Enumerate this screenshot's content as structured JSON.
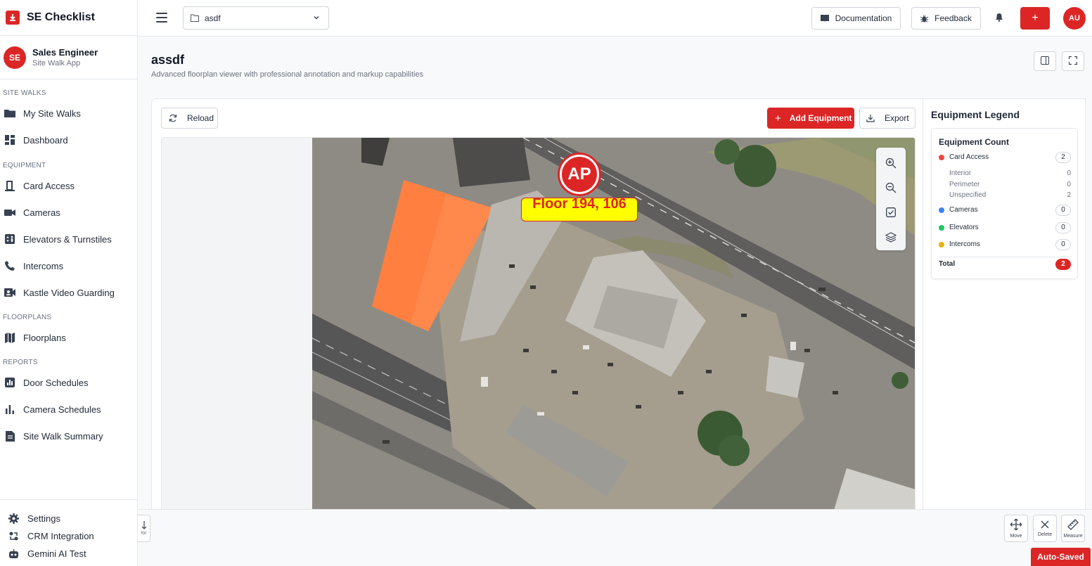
{
  "app": {
    "title": "SE Checklist"
  },
  "user": {
    "initials": "SE",
    "name": "Sales Engineer",
    "subtitle": "Site Walk App",
    "avatar_initials": "AU"
  },
  "sidebar": {
    "sections": [
      {
        "label": "SITE WALKS",
        "items": [
          {
            "label": "My Site Walks",
            "icon": "folder-icon"
          },
          {
            "label": "Dashboard",
            "icon": "dashboard-icon"
          }
        ]
      },
      {
        "label": "EQUIPMENT",
        "items": [
          {
            "label": "Card Access",
            "icon": "door-icon"
          },
          {
            "label": "Cameras",
            "icon": "video-camera-icon"
          },
          {
            "label": "Elevators & Turnstiles",
            "icon": "elevator-icon"
          },
          {
            "label": "Intercoms",
            "icon": "phone-icon"
          },
          {
            "label": "Kastle Video Guarding",
            "icon": "video-guard-icon"
          }
        ]
      },
      {
        "label": "FLOORPLANS",
        "items": [
          {
            "label": "Floorplans",
            "icon": "map-icon"
          }
        ]
      },
      {
        "label": "REPORTS",
        "items": [
          {
            "label": "Door Schedules",
            "icon": "bar-chart-icon"
          },
          {
            "label": "Camera Schedules",
            "icon": "bar-chart-icon"
          },
          {
            "label": "Site Walk Summary",
            "icon": "document-icon"
          }
        ]
      }
    ],
    "bottom": [
      {
        "label": "Settings",
        "icon": "gear-icon"
      },
      {
        "label": "CRM Integration",
        "icon": "sync-icon"
      },
      {
        "label": "Gemini AI Test",
        "icon": "robot-icon"
      }
    ]
  },
  "header": {
    "project": "asdf",
    "documentation_label": "Documentation",
    "feedback_label": "Feedback",
    "add_label": "+"
  },
  "page": {
    "title": "assdf",
    "subtitle": "Advanced floorplan viewer with professional annotation and markup capabilities"
  },
  "viewer": {
    "reload_label": "Reload",
    "add_equipment_label": "Add Equipment",
    "export_label": "Export",
    "marker": {
      "badge": "AP",
      "label": "Floor 194, 106"
    }
  },
  "legend": {
    "title": "Equipment Legend",
    "card_title": "Equipment Count",
    "items": [
      {
        "label": "Card Access",
        "count": "2",
        "color": "#ef4444"
      },
      {
        "label": "Cameras",
        "count": "0",
        "color": "#3b82f6"
      },
      {
        "label": "Elevators",
        "count": "0",
        "color": "#22c55e"
      },
      {
        "label": "Intercoms",
        "count": "0",
        "color": "#eab308"
      }
    ],
    "card_access_breakdown": [
      {
        "label": "Interior",
        "count": "0"
      },
      {
        "label": "Perimeter",
        "count": "0"
      },
      {
        "label": "Unspecified",
        "count": "2"
      }
    ],
    "total_label": "Total",
    "total_count": "2"
  },
  "toolbar": {
    "left_tool_label": "tor",
    "move_label": "Move",
    "delete_label": "Delete",
    "measure_label": "Measure"
  },
  "status": {
    "autosaved": "Auto-Saved"
  },
  "colors": {
    "accent": "#dc2626"
  }
}
